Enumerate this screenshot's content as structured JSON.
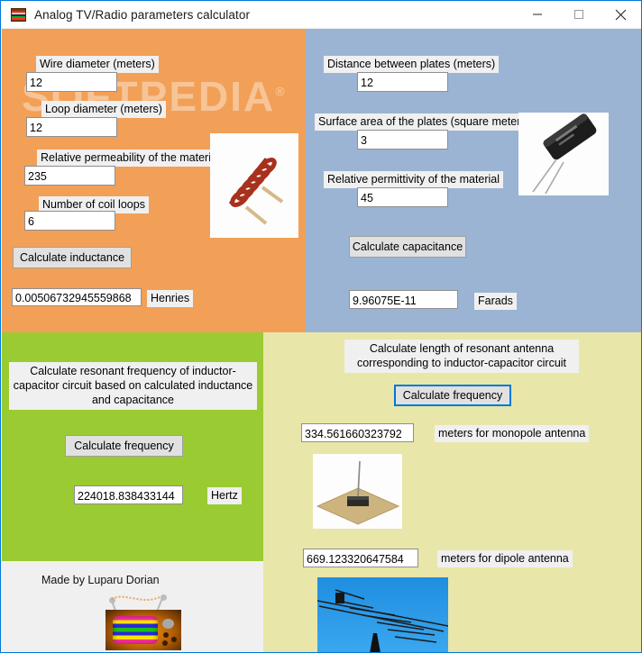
{
  "window": {
    "title": "Analog TV/Radio parameters calculator",
    "icon": "tv-icon",
    "controls": {
      "minimize": "minimize-icon",
      "maximize": "maximize-icon",
      "close": "close-icon"
    }
  },
  "watermark": {
    "text": "SOFTPEDIA",
    "mark": "®"
  },
  "inductance_panel": {
    "color": "#f2a058",
    "wire_diameter": {
      "label": "Wire diameter (meters)",
      "value": "12"
    },
    "loop_diameter": {
      "label": "Loop diameter (meters)",
      "value": "12"
    },
    "permeability": {
      "label": "Relative permeability of the material",
      "value": "235"
    },
    "coil_loops": {
      "label": "Number of coil loops",
      "value": "6"
    },
    "calculate_button": "Calculate inductance",
    "result": {
      "value": "0.00506732945559868",
      "unit": "Henries"
    },
    "image": "inductor-coil-photo"
  },
  "capacitance_panel": {
    "color": "#9bb4d4",
    "plate_distance": {
      "label": "Distance between plates (meters)",
      "value": "12"
    },
    "plate_area": {
      "label": "Surface area of the plates (square meters)",
      "value": "3"
    },
    "permittivity": {
      "label": "Relative permittivity of the material",
      "value": "45"
    },
    "calculate_button": "Calculate capacitance",
    "result": {
      "value": "9.96075E-11",
      "unit": "Farads"
    },
    "image": "electrolytic-capacitor-photo"
  },
  "frequency_panel": {
    "color": "#9bcb32",
    "description": "Calculate resonant frequency of inductor-capacitor circuit based on calculated inductance and capacitance",
    "calculate_button": "Calculate frequency",
    "result": {
      "value": "224018.838433144",
      "unit": "Hertz"
    }
  },
  "antenna_panel": {
    "color": "#e9e6a9",
    "description": "Calculate length of resonant antenna corresponding to inductor-capacitor circuit",
    "calculate_button": "Calculate frequency",
    "monopole": {
      "value": "334.561660323792",
      "unit": "meters for monopole antenna",
      "image": "monopole-antenna-photo"
    },
    "dipole": {
      "value": "669.123320647584",
      "unit": "meters for dipole antenna",
      "image": "dipole-yagi-antenna-photo"
    }
  },
  "footer": {
    "credit": "Made by Luparu Dorian",
    "logo": "tv-logo"
  }
}
